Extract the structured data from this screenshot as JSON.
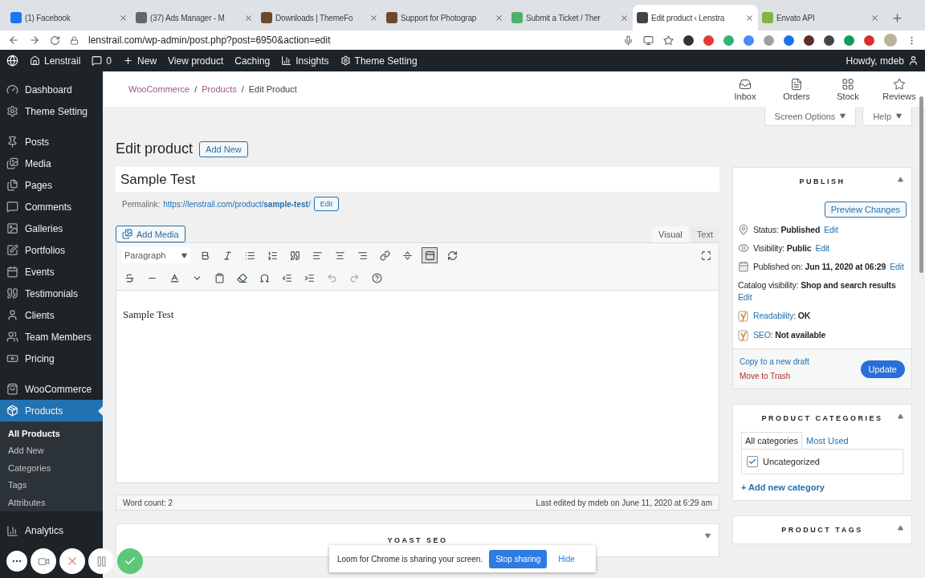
{
  "browser": {
    "tabs": [
      {
        "title": "(1) Facebook",
        "selected": false
      },
      {
        "title": "(37) Ads Manager - M",
        "selected": false
      },
      {
        "title": "Downloads | ThemeFo",
        "selected": false
      },
      {
        "title": "Support for Photograp",
        "selected": false
      },
      {
        "title": "Submit a Ticket / Ther",
        "selected": false
      },
      {
        "title": "Edit product ‹ Lenstra",
        "selected": true
      },
      {
        "title": "Envato API",
        "selected": false
      }
    ],
    "address": "lenstrail.com/wp-admin/post.php?post=6950&action=edit"
  },
  "admin_bar": {
    "site": "Lenstrail",
    "comments": "0",
    "new": "New",
    "items": [
      "View product",
      "Caching",
      "Insights",
      "Theme Setting"
    ],
    "greeting": "Howdy, mdeb"
  },
  "sidebar": {
    "groups": [
      [
        {
          "label": "Dashboard",
          "selected": false
        },
        {
          "label": "Theme Setting",
          "selected": false
        }
      ],
      [
        {
          "label": "Posts",
          "selected": false
        },
        {
          "label": "Media",
          "selected": false
        },
        {
          "label": "Pages",
          "selected": false
        },
        {
          "label": "Comments",
          "selected": false
        },
        {
          "label": "Galleries",
          "selected": false
        },
        {
          "label": "Portfolios",
          "selected": false
        },
        {
          "label": "Events",
          "selected": false
        },
        {
          "label": "Testimonials",
          "selected": false
        },
        {
          "label": "Clients",
          "selected": false
        },
        {
          "label": "Team Members",
          "selected": false
        },
        {
          "label": "Pricing",
          "selected": false
        }
      ],
      [
        {
          "label": "WooCommerce",
          "selected": false
        },
        {
          "label": "Products",
          "selected": true,
          "children": [
            {
              "label": "All Products",
              "selected": true
            },
            {
              "label": "Add New",
              "selected": false
            },
            {
              "label": "Categories",
              "selected": false
            },
            {
              "label": "Tags",
              "selected": false
            },
            {
              "label": "Attributes",
              "selected": false
            }
          ]
        }
      ],
      [
        {
          "label": "Analytics",
          "selected": false
        }
      ]
    ]
  },
  "header": {
    "breadcrumbs": [
      "WooCommerce",
      "Products"
    ],
    "separator": "/",
    "current": "Edit Product",
    "activity": [
      "Inbox",
      "Orders",
      "Stock",
      "Reviews"
    ]
  },
  "screen_tabs": [
    "Screen Options",
    "Help"
  ],
  "page": {
    "heading": "Edit product",
    "add_new": "Add New",
    "title": "Sample Test",
    "permalink_label": "Permalink:",
    "permalink": "https://lenstrail.com/product/**sample-test**/",
    "permalink_edit": "Edit",
    "add_media": "Add Media",
    "editor_tabs": [
      {
        "label": "Visual",
        "selected": true
      },
      {
        "label": "Text",
        "selected": false
      }
    ],
    "format": "Paragraph",
    "toolbar_toggle_on": true,
    "content": "Sample Test",
    "word_count": "Word count: 2",
    "last_edited": "Last edited by mdeb on June 11, 2020 at 6:29 am"
  },
  "yoast": {
    "title": "YOAST SEO"
  },
  "publish": {
    "title": "PUBLISH",
    "preview": "Preview Changes",
    "rows": [
      {
        "kind": "status",
        "text": "Status: **Published**",
        "edit": "Edit"
      },
      {
        "kind": "visibility",
        "text": "Visibility: **Public**",
        "edit": "Edit"
      },
      {
        "kind": "date",
        "text": "Published on: **Jun 11, 2020 at 06:29**",
        "edit": "Edit"
      },
      {
        "kind": "catalog",
        "text": "Catalog visibility: **Shop and search results**",
        "edit": "Edit"
      },
      {
        "kind": "readability",
        "link": "Readability",
        "text": ": **OK**"
      },
      {
        "kind": "seo",
        "link": "SEO",
        "text": ": **Not available**"
      }
    ],
    "copy": "Copy to a new draft",
    "trash": "Move to Trash",
    "update": "Update"
  },
  "categories": {
    "title": "PRODUCT CATEGORIES",
    "tabs": [
      {
        "label": "All categories",
        "selected": true
      },
      {
        "label": "Most Used",
        "selected": false
      }
    ],
    "items": [
      {
        "label": "Uncategorized",
        "checked": true
      }
    ],
    "add": "+ Add new category"
  },
  "tags": {
    "title": "PRODUCT TAGS"
  },
  "loom": {
    "message": "Loom for Chrome is sharing your screen.",
    "stop": "Stop sharing",
    "hide": "Hide"
  }
}
